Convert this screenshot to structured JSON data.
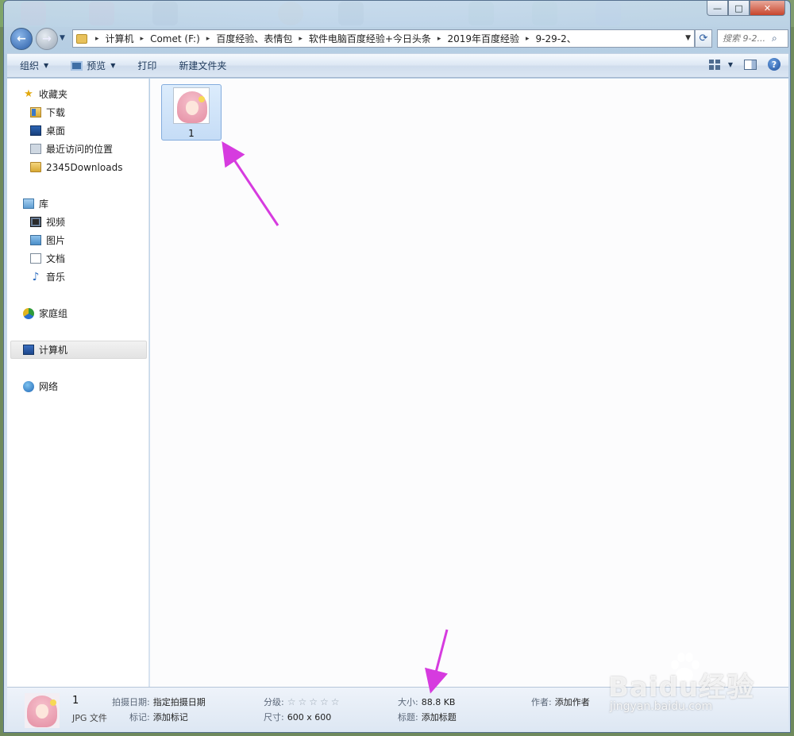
{
  "window": {
    "caption": {
      "minimize": "—",
      "maximize": "□",
      "close": "✕"
    }
  },
  "address": {
    "crumbs": [
      "计算机",
      "Comet (F:)",
      "百度经验、表情包",
      "软件电脑百度经验+今日头条",
      "2019年百度经验",
      "9-29-2、"
    ],
    "search_placeholder": "搜索 9-2..."
  },
  "toolbar": {
    "organize": "组织",
    "preview": "预览",
    "print": "打印",
    "new_folder": "新建文件夹"
  },
  "nav": {
    "favorites": {
      "label": "收藏夹",
      "items": [
        "下载",
        "桌面",
        "最近访问的位置",
        "2345Downloads"
      ]
    },
    "libraries": {
      "label": "库",
      "items": [
        "视频",
        "图片",
        "文档",
        "音乐"
      ]
    },
    "homegroup": "家庭组",
    "computer": "计算机",
    "network": "网络"
  },
  "files": [
    {
      "name": "1"
    }
  ],
  "details": {
    "name": "1",
    "type": "JPG 文件",
    "date_taken_label": "拍摄日期:",
    "date_taken_value": "指定拍摄日期",
    "tags_label": "标记:",
    "tags_value": "添加标记",
    "rating_label": "分级:",
    "rating_stars": "☆☆☆☆☆",
    "rating_value": 0,
    "dimensions_label": "尺寸:",
    "dimensions_value": "600 x 600",
    "size_label": "大小:",
    "size_value": "88.8 KB",
    "title_label": "标题:",
    "title_value": "添加标题",
    "author_label": "作者:",
    "author_value": "添加作者"
  },
  "watermark": {
    "brand": "Baidu经验",
    "url": "jingyan.baidu.com"
  },
  "colors": {
    "annotation_arrow": "#d63bdf",
    "selection_fill": "#cde1f8",
    "toolbar_text": "#1e395b"
  }
}
